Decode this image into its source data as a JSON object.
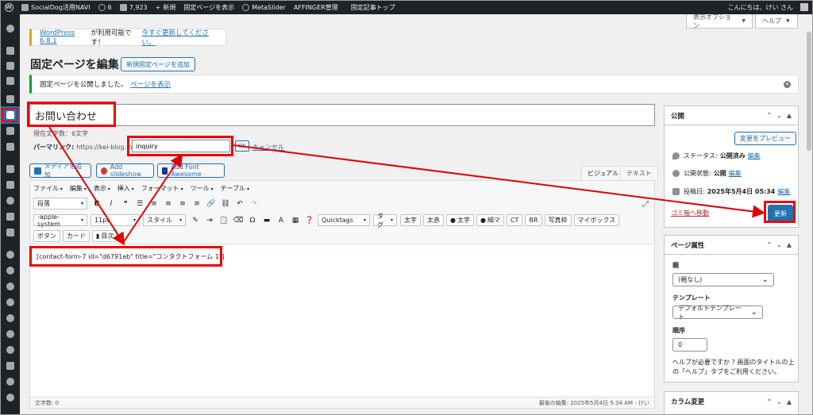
{
  "adminbar": {
    "site_name": "SocialDog活用NAVI",
    "updates_count": "6",
    "comments_count": "7,923",
    "new_label": "新規",
    "view_page": "固定ページを表示",
    "metaslider": "MetaSlider",
    "affinger": "AFFINGER管理",
    "fixed_top": "固定記事トップ",
    "greeting": "こんにちは、けい さん"
  },
  "screen_meta": {
    "options": "表示オプション",
    "help": "ヘルプ"
  },
  "notice_update": {
    "prefix": "WordPress 6.8.1",
    "middle": " が利用可能です！",
    "link": "今すぐ更新してください。"
  },
  "heading": {
    "title": "固定ページを編集",
    "add_new": "新規固定ページを追加"
  },
  "notice_success": {
    "text": "固定ページを公開しました。",
    "link": "ページを表示"
  },
  "post": {
    "title": "お問い合わせ",
    "char_count": "現在文字数：6文字",
    "permalink_label": "パーマリンク:",
    "permalink_url": "https://kei-blog.info/",
    "slug": "inquiry",
    "ok": "OK",
    "cancel": "キャンセル"
  },
  "media": {
    "add_media": "メディアを追加",
    "add_slideshow": "Add slideshow",
    "add_font_awesome": "Add Font Awesome"
  },
  "editor_tabs": {
    "visual": "ビジュアル",
    "text": "テキスト"
  },
  "menubar": [
    "ファイル",
    "編集",
    "表示",
    "挿入",
    "フォーマット",
    "ツール",
    "テーブル"
  ],
  "toolbar": {
    "paragraph": "段落",
    "font_family": "-apple-system",
    "font_size": "11pt",
    "style": "スタイル",
    "quicktags": "Quicktags",
    "tag": "タグ",
    "row2_buttons": [
      "太字",
      "太赤"
    ],
    "futo": "太字",
    "hoso": "細マ",
    "row2_tail": [
      "CT",
      "BR",
      "写真枠",
      "マイボックス"
    ],
    "row3_buttons": [
      "ボタン",
      "カード"
    ],
    "toc": "目次"
  },
  "editor": {
    "content": "[contact-form-7 id=\"d6791eb\" title=\"コンタクトフォーム 1\"]",
    "word_count": "文字数: 0",
    "last_edit": "最後の編集: 2025年5月4日 5:34 AM - けい"
  },
  "publish_box": {
    "title": "公開",
    "preview": "変更をプレビュー",
    "status_label": "ステータス:",
    "status_value": "公開済み",
    "visibility_label": "公開状態:",
    "visibility_value": "公開",
    "date_label": "投稿日:",
    "date_value": "2025年5月4日 05:34",
    "edit": "編集",
    "trash": "ゴミ箱へ移動",
    "update": "更新"
  },
  "page_attributes": {
    "title": "ページ属性",
    "parent_label": "親",
    "parent_value": "(親なし)",
    "template_label": "テンプレート",
    "template_value": "デフォルトテンプレート",
    "order_label": "順序",
    "order_value": "0",
    "help": "ヘルプが必要ですか ? 画面のタイトルの上の「ヘルプ」タブをご利用ください。"
  },
  "column_box": {
    "title": "カラム変更"
  },
  "colors": {
    "accent": "#2271b1",
    "annotation_red": "#e00000",
    "admin_dark": "#1d2327"
  }
}
